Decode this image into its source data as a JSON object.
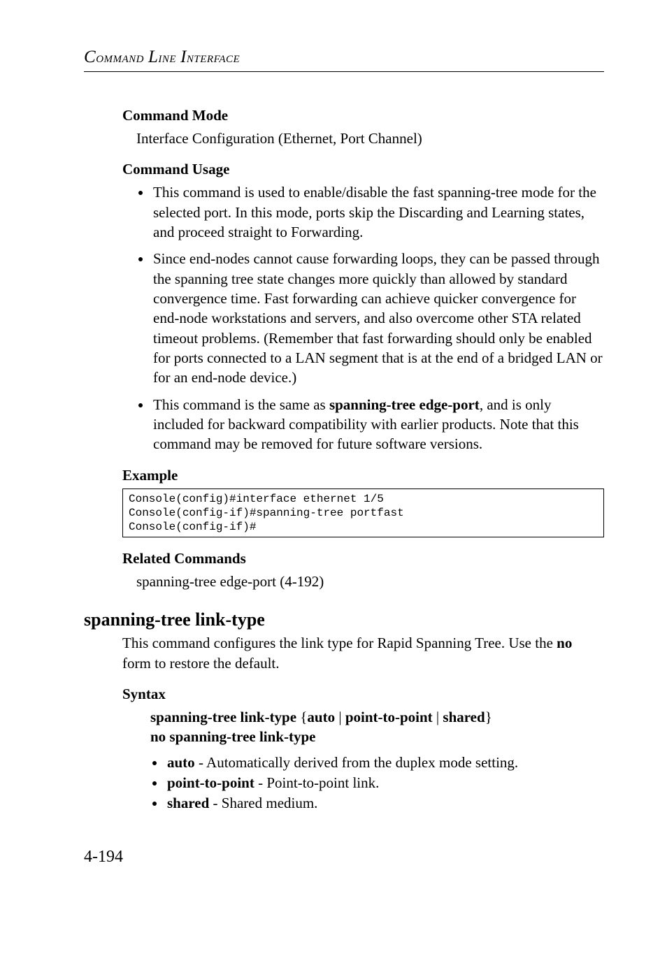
{
  "header": {
    "text": "Command Line Interface"
  },
  "s1": {
    "h1": "Command Mode",
    "p1": "Interface Configuration (Ethernet, Port Channel)",
    "h2": "Command Usage",
    "b1": "This command is used to enable/disable the fast spanning-tree mode for the selected port. In this mode, ports skip the Discarding and Learning states, and proceed straight to Forwarding.",
    "b2": "Since end-nodes cannot cause forwarding loops, they can be passed through the spanning tree state changes more quickly than allowed by standard convergence time. Fast forwarding can achieve quicker convergence for end-node workstations and servers, and also overcome other STA related timeout problems. (Remember that fast forwarding should only be enabled for ports connected to a LAN segment that is at the end of a bridged LAN or for an end-node device.)",
    "b3_pre": "This command is the same as ",
    "b3_bold": "spanning-tree edge-port",
    "b3_post": ", and is only included for backward compatibility with earlier products. Note that this command may be removed for future software versions.",
    "h3": "Example",
    "code": "Console(config)#interface ethernet 1/5\nConsole(config-if)#spanning-tree portfast\nConsole(config-if)#",
    "h4": "Related Commands",
    "p2": "spanning-tree edge-port (4-192)"
  },
  "s2": {
    "title": "spanning-tree link-type",
    "intro_pre": "This command configures the link type for Rapid Spanning Tree. Use the ",
    "intro_bold": "no",
    "intro_post": " form to restore the default.",
    "h1": "Syntax",
    "syntax_l1_b1": "spanning-tree link-type",
    "syntax_l1_t1": " {",
    "syntax_l1_b2": "auto",
    "syntax_l1_t2": " | ",
    "syntax_l1_b3": "point-to-point",
    "syntax_l1_t3": " | ",
    "syntax_l1_b4": "shared",
    "syntax_l1_t4": "}",
    "syntax_l2": "no spanning-tree link-type",
    "opt1_b": "auto",
    "opt1_t": " - Automatically derived from the duplex mode setting.",
    "opt2_b": "point-to-point",
    "opt2_t": " - Point-to-point link.",
    "opt3_b": "shared",
    "opt3_t": " - Shared medium."
  },
  "footer": {
    "pagenum": "4-194"
  }
}
